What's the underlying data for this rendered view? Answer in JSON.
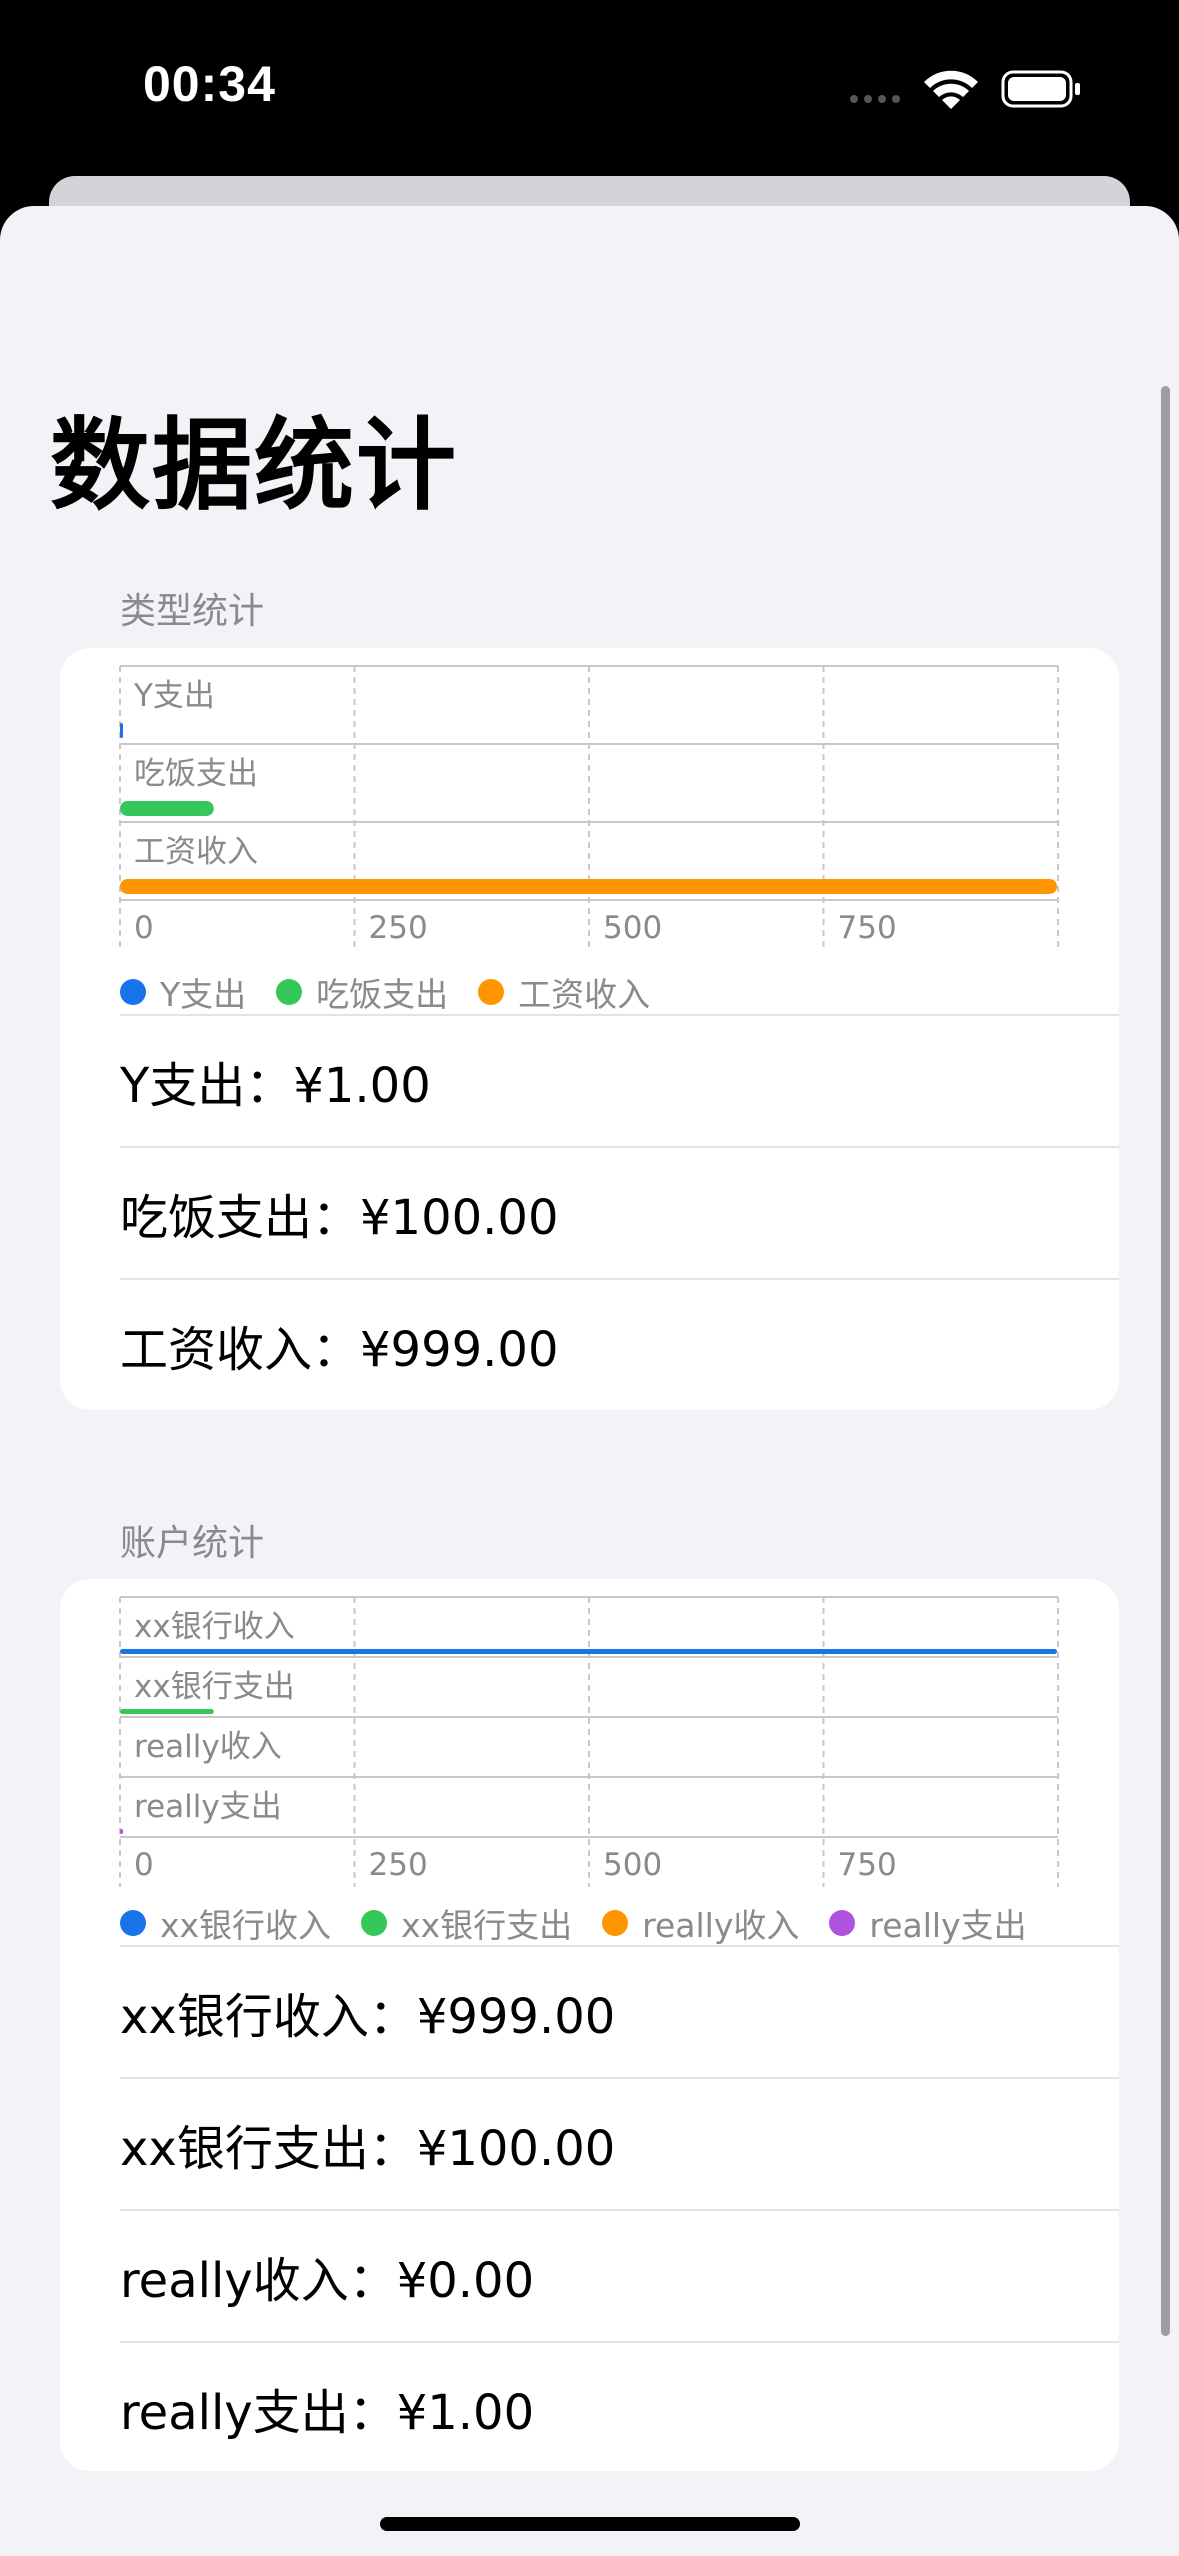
{
  "status_bar": {
    "time": "00:34"
  },
  "page": {
    "title": "数据统计"
  },
  "colors": {
    "blue": "#1a73e8",
    "green": "#34c759",
    "orange": "#ff9500",
    "purple": "#af52de"
  },
  "type_section": {
    "header": "类型统计",
    "rows": [
      "Y支出：¥1.00",
      "吃饭支出：¥100.00",
      "工资收入：¥999.00"
    ]
  },
  "account_section": {
    "header": "账户统计",
    "rows": [
      "xx银行收入：¥999.00",
      "xx银行支出：¥100.00",
      "really收入：¥0.00",
      "really支出：¥1.00"
    ]
  },
  "chart_data": [
    {
      "type": "bar",
      "orientation": "horizontal",
      "categories": [
        "Y支出",
        "吃饭支出",
        "工资收入"
      ],
      "series": [
        {
          "name": "Y支出"
        },
        {
          "name": "吃饭支出"
        },
        {
          "name": "工资收入"
        }
      ],
      "values": [
        1,
        100,
        999
      ],
      "xlim": [
        0,
        1000
      ],
      "x_ticks": [
        "0",
        "250",
        "500",
        "750"
      ],
      "colors": [
        "#1a73e8",
        "#34c759",
        "#ff9500"
      ],
      "legend": "bottom",
      "grid": true
    },
    {
      "type": "bar",
      "orientation": "horizontal",
      "categories": [
        "xx银行收入",
        "xx银行支出",
        "really收入",
        "really支出"
      ],
      "series": [
        {
          "name": "xx银行收入"
        },
        {
          "name": "xx银行支出"
        },
        {
          "name": "really收入"
        },
        {
          "name": "really支出"
        }
      ],
      "values": [
        999,
        100,
        0,
        1
      ],
      "xlim": [
        0,
        1000
      ],
      "x_ticks": [
        "0",
        "250",
        "500",
        "750"
      ],
      "colors": [
        "#1a73e8",
        "#34c759",
        "#ff9500",
        "#af52de"
      ],
      "legend": "bottom",
      "grid": true
    }
  ]
}
